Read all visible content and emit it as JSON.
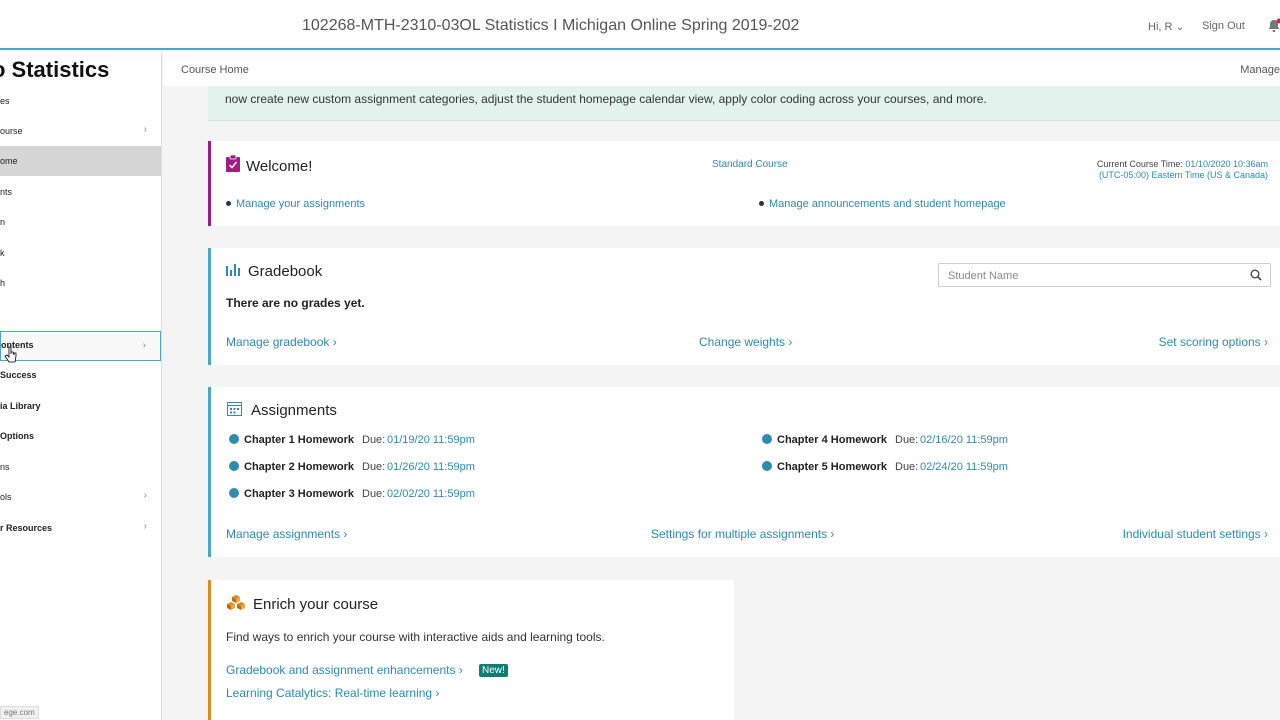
{
  "topbar": {
    "course_title": "102268-MTH-2310-03OL Statistics I Michigan Online Spring 2019-202",
    "greeting": "Hi, R ⌄",
    "sign_out": "Sign Out"
  },
  "sidebar": {
    "title": "o Statistics",
    "items": [
      {
        "label": "es",
        "chevron": false
      },
      {
        "label": "ourse",
        "chevron": true
      },
      {
        "label": "ome",
        "chevron": false
      },
      {
        "label": "nts",
        "chevron": false
      },
      {
        "label": "n",
        "chevron": false
      },
      {
        "label": "k",
        "chevron": false
      },
      {
        "label": "h",
        "chevron": false
      },
      {
        "label": "",
        "chevron": false
      },
      {
        "label": "ontents",
        "chevron": true
      },
      {
        "label": "Success",
        "chevron": false
      },
      {
        "label": "ia Library",
        "chevron": false
      },
      {
        "label": "Options",
        "chevron": false
      },
      {
        "label": "ns",
        "chevron": false
      },
      {
        "label": "ols",
        "chevron": true
      },
      {
        "label": "r Resources",
        "chevron": true
      }
    ],
    "footer": "ege.com"
  },
  "breadcrumb": {
    "label": "Course Home",
    "right": "Manage"
  },
  "banner": {
    "text": "now create new custom assignment categories, adjust the student homepage calendar view, apply color coding across your courses, and more."
  },
  "welcome": {
    "title": "Welcome!",
    "course_type": "Standard Course",
    "time_label": "Current Course Time:",
    "time_value": "01/10/2020 10:36am",
    "timezone": "(UTC-05:00) Eastern Time (US & Canada)",
    "link1": "Manage your assignments",
    "link2": "Manage announcements and student homepage",
    "accent": "#9e1e83"
  },
  "gradebook": {
    "title": "Gradebook",
    "search_placeholder": "Student Name",
    "no_grades": "There are no grades yet.",
    "link_manage": "Manage gradebook ›",
    "link_weights": "Change weights ›",
    "link_scoring": "Set scoring options ›"
  },
  "assignments": {
    "title": "Assignments",
    "due_label": "Due:",
    "items": [
      {
        "name": "Chapter 1 Homework",
        "due": "01/19/20 11:59pm"
      },
      {
        "name": "Chapter 2 Homework",
        "due": "01/26/20 11:59pm"
      },
      {
        "name": "Chapter 3 Homework",
        "due": "02/02/20 11:59pm"
      },
      {
        "name": "Chapter 4 Homework",
        "due": "02/16/20 11:59pm"
      },
      {
        "name": "Chapter 5 Homework",
        "due": "02/24/20 11:59pm"
      }
    ],
    "link_manage": "Manage assignments ›",
    "link_settings": "Settings for multiple assignments ›",
    "link_individual": "Individual student settings ›"
  },
  "enrich": {
    "title": "Enrich your course",
    "description": "Find ways to enrich your course with interactive aids and learning tools.",
    "link1": "Gradebook and assignment enhancements ›",
    "badge": "New!",
    "link2": "Learning Catalytics: Real-time learning ›",
    "accent": "#e08a1e"
  }
}
